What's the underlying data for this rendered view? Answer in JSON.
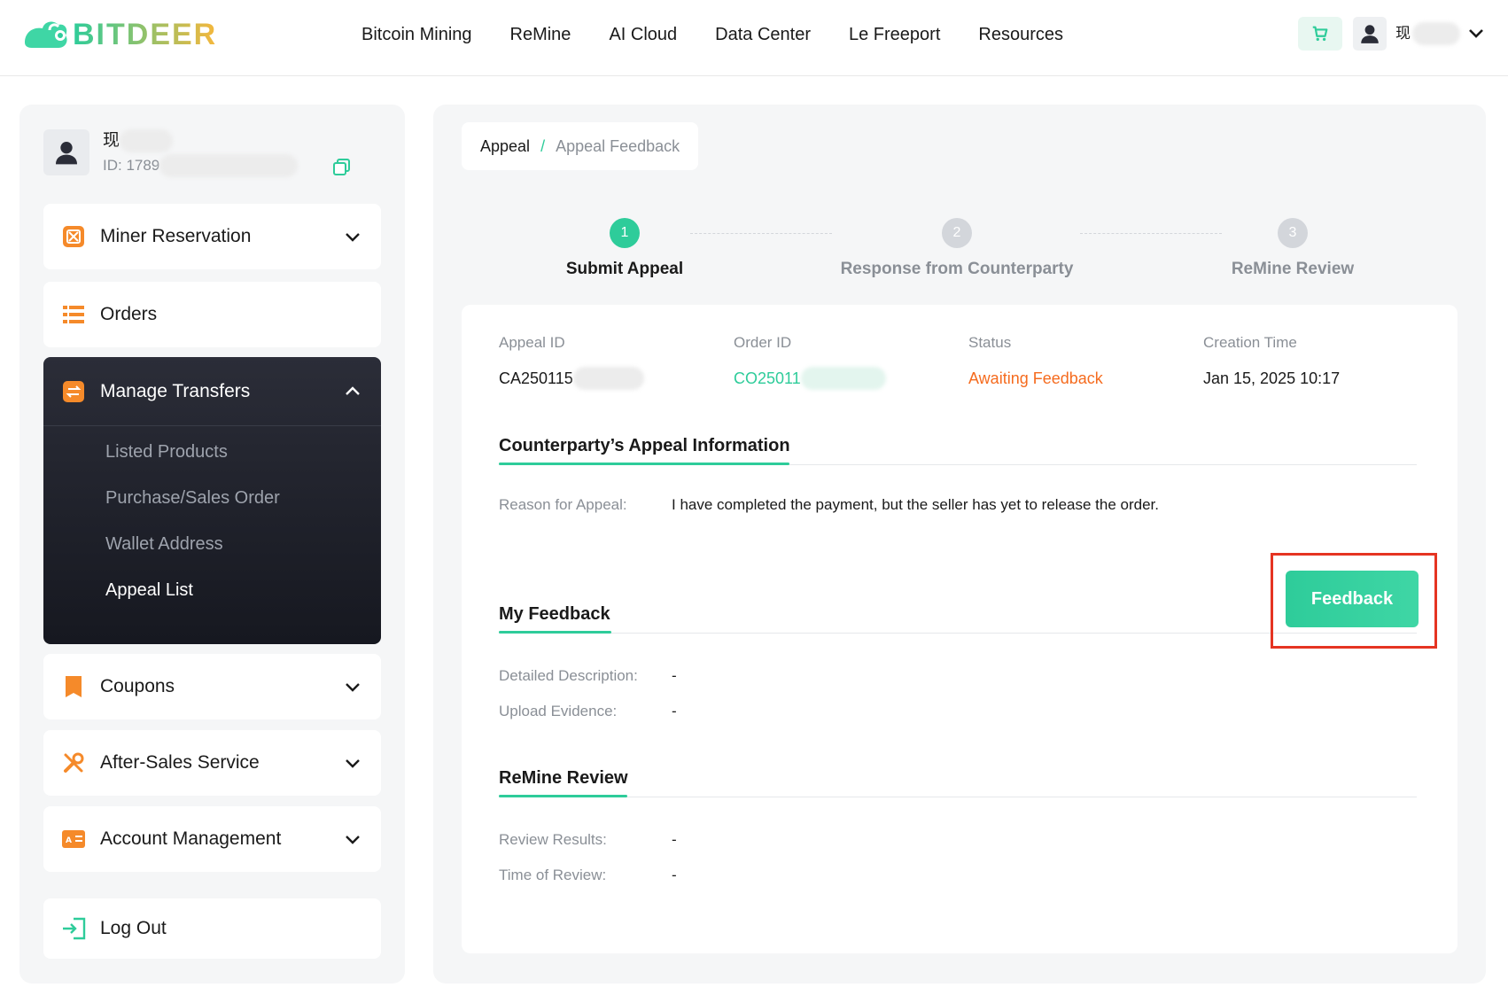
{
  "colors": {
    "accent": "#2ecc9a",
    "warning": "#f56b1e",
    "dark_panel": "#1f212b",
    "highlight": "#e53422"
  },
  "header": {
    "brand": "BITDEER",
    "nav": [
      "Bitcoin Mining",
      "ReMine",
      "AI Cloud",
      "Data Center",
      "Le Freeport",
      "Resources"
    ],
    "user_name": "现",
    "icons": [
      "cart-icon",
      "user-icon",
      "chevron-down-icon"
    ]
  },
  "sidebar": {
    "profile": {
      "name": "现",
      "id": "ID: 1789"
    },
    "menu": {
      "miner_reservation": "Miner Reservation",
      "orders": "Orders",
      "manage_transfers": "Manage Transfers",
      "coupons": "Coupons",
      "after_sales": "After-Sales Service",
      "account_management": "Account Management",
      "log_out": "Log Out"
    },
    "transfers_sub": [
      "Listed Products",
      "Purchase/Sales Order",
      "Wallet Address",
      "Appeal List"
    ],
    "active_sub": "Appeal List"
  },
  "breadcrumb": {
    "parent": "Appeal",
    "separator": "/",
    "current": "Appeal Feedback"
  },
  "steps": [
    {
      "num": "1",
      "label": "Submit Appeal",
      "state": "active"
    },
    {
      "num": "2",
      "label": "Response from Counterparty",
      "state": "pending"
    },
    {
      "num": "3",
      "label": "ReMine Review",
      "state": "pending"
    }
  ],
  "appeal": {
    "labels": {
      "appeal_id": "Appeal ID",
      "order_id": "Order ID",
      "status": "Status",
      "creation_time": "Creation Time"
    },
    "values": {
      "appeal_id": "CA250115",
      "order_id": "CO25011",
      "status": "Awaiting Feedback",
      "creation_time": "Jan 15, 2025 10:17"
    }
  },
  "counterparty": {
    "title": "Counterparty’s Appeal Information",
    "reason_label": "Reason for Appeal:",
    "reason_value": "I have completed the payment, but the seller has yet to release the order."
  },
  "my_feedback": {
    "title": "My Feedback",
    "button": "Feedback",
    "desc_label": "Detailed Description:",
    "desc_value": "-",
    "evidence_label": "Upload Evidence:",
    "evidence_value": "-"
  },
  "review": {
    "title": "ReMine Review",
    "results_label": "Review Results:",
    "results_value": "-",
    "time_label": "Time of Review:",
    "time_value": "-"
  }
}
